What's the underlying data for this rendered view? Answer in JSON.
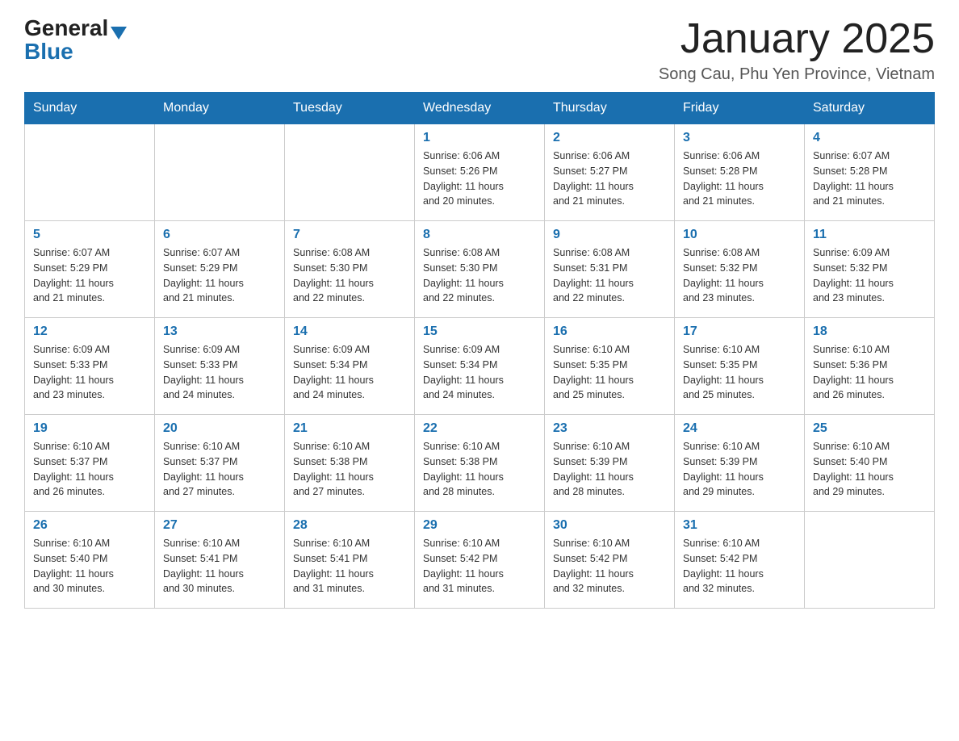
{
  "header": {
    "logo_general": "General",
    "logo_blue": "Blue",
    "title": "January 2025",
    "subtitle": "Song Cau, Phu Yen Province, Vietnam"
  },
  "days_of_week": [
    "Sunday",
    "Monday",
    "Tuesday",
    "Wednesday",
    "Thursday",
    "Friday",
    "Saturday"
  ],
  "weeks": [
    [
      {
        "day": "",
        "info": ""
      },
      {
        "day": "",
        "info": ""
      },
      {
        "day": "",
        "info": ""
      },
      {
        "day": "1",
        "info": "Sunrise: 6:06 AM\nSunset: 5:26 PM\nDaylight: 11 hours\nand 20 minutes."
      },
      {
        "day": "2",
        "info": "Sunrise: 6:06 AM\nSunset: 5:27 PM\nDaylight: 11 hours\nand 21 minutes."
      },
      {
        "day": "3",
        "info": "Sunrise: 6:06 AM\nSunset: 5:28 PM\nDaylight: 11 hours\nand 21 minutes."
      },
      {
        "day": "4",
        "info": "Sunrise: 6:07 AM\nSunset: 5:28 PM\nDaylight: 11 hours\nand 21 minutes."
      }
    ],
    [
      {
        "day": "5",
        "info": "Sunrise: 6:07 AM\nSunset: 5:29 PM\nDaylight: 11 hours\nand 21 minutes."
      },
      {
        "day": "6",
        "info": "Sunrise: 6:07 AM\nSunset: 5:29 PM\nDaylight: 11 hours\nand 21 minutes."
      },
      {
        "day": "7",
        "info": "Sunrise: 6:08 AM\nSunset: 5:30 PM\nDaylight: 11 hours\nand 22 minutes."
      },
      {
        "day": "8",
        "info": "Sunrise: 6:08 AM\nSunset: 5:30 PM\nDaylight: 11 hours\nand 22 minutes."
      },
      {
        "day": "9",
        "info": "Sunrise: 6:08 AM\nSunset: 5:31 PM\nDaylight: 11 hours\nand 22 minutes."
      },
      {
        "day": "10",
        "info": "Sunrise: 6:08 AM\nSunset: 5:32 PM\nDaylight: 11 hours\nand 23 minutes."
      },
      {
        "day": "11",
        "info": "Sunrise: 6:09 AM\nSunset: 5:32 PM\nDaylight: 11 hours\nand 23 minutes."
      }
    ],
    [
      {
        "day": "12",
        "info": "Sunrise: 6:09 AM\nSunset: 5:33 PM\nDaylight: 11 hours\nand 23 minutes."
      },
      {
        "day": "13",
        "info": "Sunrise: 6:09 AM\nSunset: 5:33 PM\nDaylight: 11 hours\nand 24 minutes."
      },
      {
        "day": "14",
        "info": "Sunrise: 6:09 AM\nSunset: 5:34 PM\nDaylight: 11 hours\nand 24 minutes."
      },
      {
        "day": "15",
        "info": "Sunrise: 6:09 AM\nSunset: 5:34 PM\nDaylight: 11 hours\nand 24 minutes."
      },
      {
        "day": "16",
        "info": "Sunrise: 6:10 AM\nSunset: 5:35 PM\nDaylight: 11 hours\nand 25 minutes."
      },
      {
        "day": "17",
        "info": "Sunrise: 6:10 AM\nSunset: 5:35 PM\nDaylight: 11 hours\nand 25 minutes."
      },
      {
        "day": "18",
        "info": "Sunrise: 6:10 AM\nSunset: 5:36 PM\nDaylight: 11 hours\nand 26 minutes."
      }
    ],
    [
      {
        "day": "19",
        "info": "Sunrise: 6:10 AM\nSunset: 5:37 PM\nDaylight: 11 hours\nand 26 minutes."
      },
      {
        "day": "20",
        "info": "Sunrise: 6:10 AM\nSunset: 5:37 PM\nDaylight: 11 hours\nand 27 minutes."
      },
      {
        "day": "21",
        "info": "Sunrise: 6:10 AM\nSunset: 5:38 PM\nDaylight: 11 hours\nand 27 minutes."
      },
      {
        "day": "22",
        "info": "Sunrise: 6:10 AM\nSunset: 5:38 PM\nDaylight: 11 hours\nand 28 minutes."
      },
      {
        "day": "23",
        "info": "Sunrise: 6:10 AM\nSunset: 5:39 PM\nDaylight: 11 hours\nand 28 minutes."
      },
      {
        "day": "24",
        "info": "Sunrise: 6:10 AM\nSunset: 5:39 PM\nDaylight: 11 hours\nand 29 minutes."
      },
      {
        "day": "25",
        "info": "Sunrise: 6:10 AM\nSunset: 5:40 PM\nDaylight: 11 hours\nand 29 minutes."
      }
    ],
    [
      {
        "day": "26",
        "info": "Sunrise: 6:10 AM\nSunset: 5:40 PM\nDaylight: 11 hours\nand 30 minutes."
      },
      {
        "day": "27",
        "info": "Sunrise: 6:10 AM\nSunset: 5:41 PM\nDaylight: 11 hours\nand 30 minutes."
      },
      {
        "day": "28",
        "info": "Sunrise: 6:10 AM\nSunset: 5:41 PM\nDaylight: 11 hours\nand 31 minutes."
      },
      {
        "day": "29",
        "info": "Sunrise: 6:10 AM\nSunset: 5:42 PM\nDaylight: 11 hours\nand 31 minutes."
      },
      {
        "day": "30",
        "info": "Sunrise: 6:10 AM\nSunset: 5:42 PM\nDaylight: 11 hours\nand 32 minutes."
      },
      {
        "day": "31",
        "info": "Sunrise: 6:10 AM\nSunset: 5:42 PM\nDaylight: 11 hours\nand 32 minutes."
      },
      {
        "day": "",
        "info": ""
      }
    ]
  ]
}
